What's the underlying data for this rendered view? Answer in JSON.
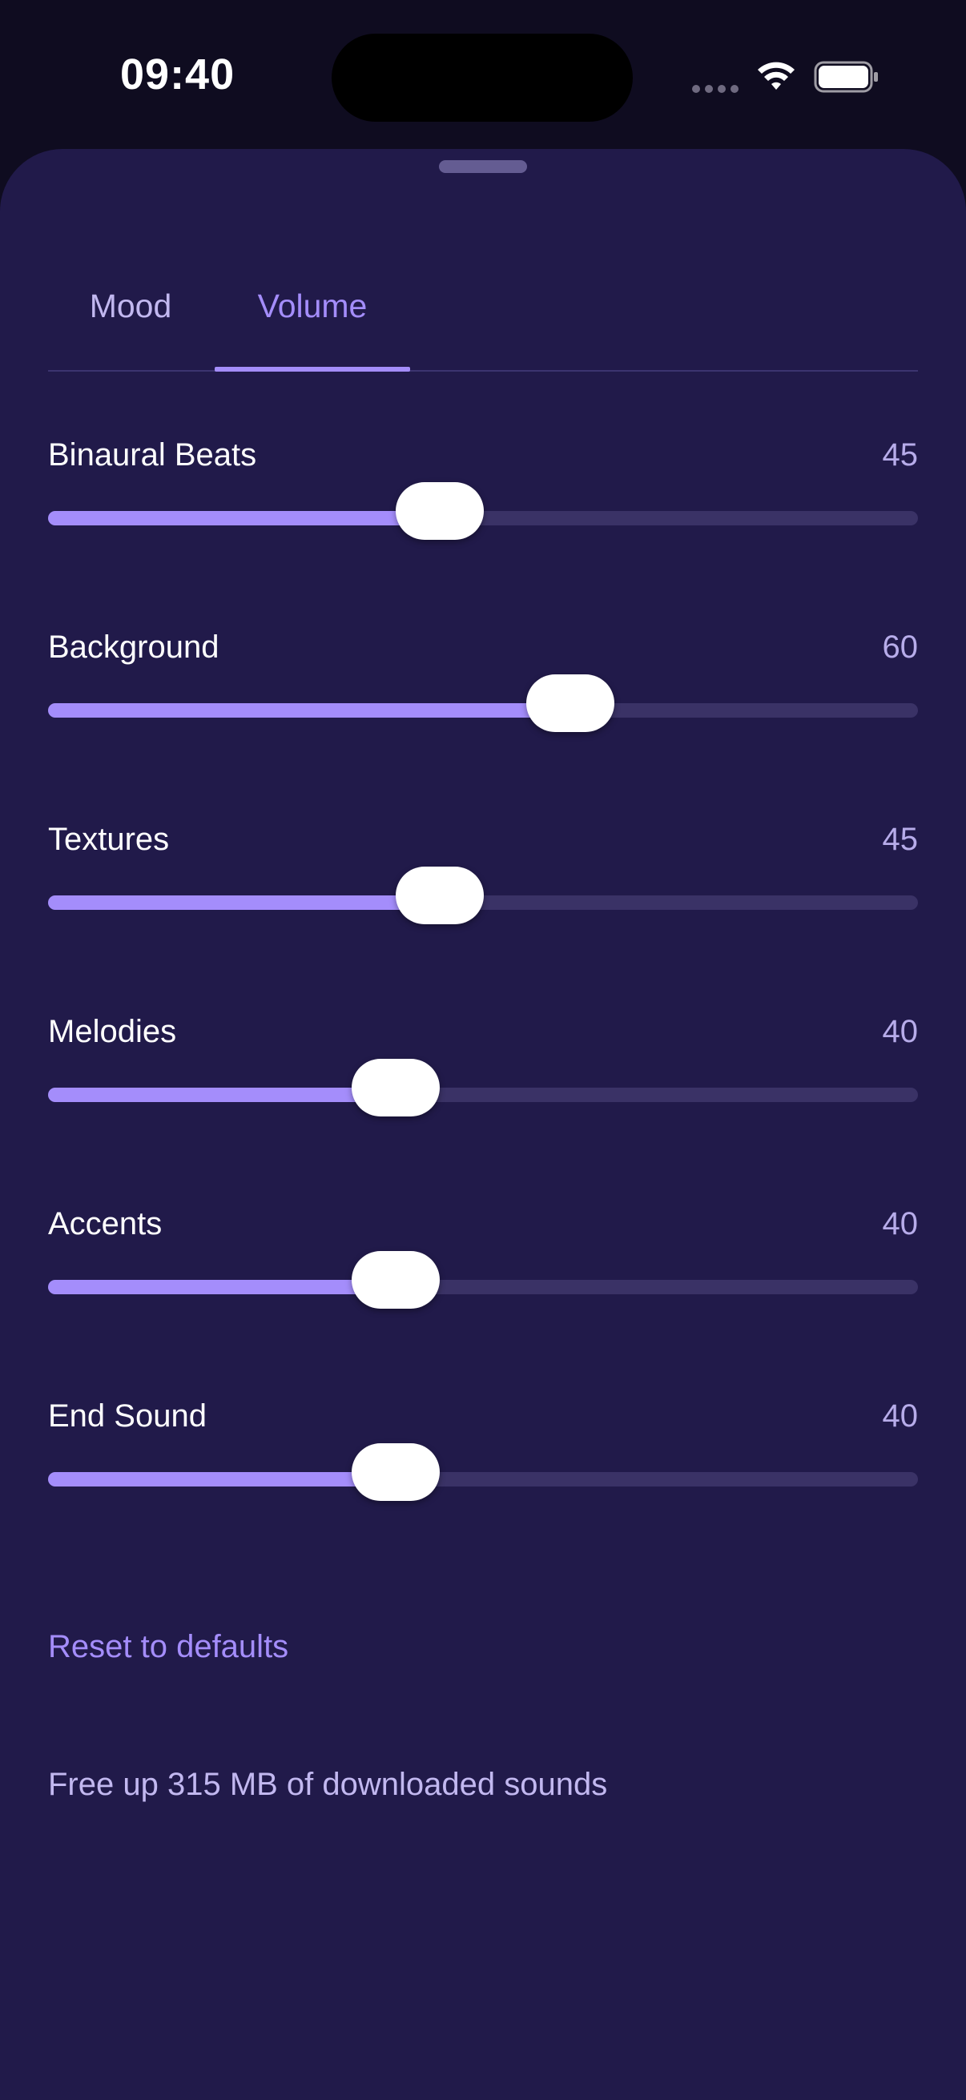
{
  "status_bar": {
    "time": "09:40",
    "icons": [
      "cellular-signal-icon",
      "wifi-icon",
      "battery-icon"
    ]
  },
  "tabs": [
    {
      "label": "Mood",
      "selected": false
    },
    {
      "label": "Volume",
      "selected": true
    }
  ],
  "sliders": [
    {
      "label": "Binaural Beats",
      "value": "45",
      "level": 0.45
    },
    {
      "label": "Background",
      "value": "60",
      "level": 0.6
    },
    {
      "label": "Textures",
      "value": "45",
      "level": 0.45
    },
    {
      "label": "Melodies",
      "value": "40",
      "level": 0.4
    },
    {
      "label": "Accents",
      "value": "40",
      "level": 0.4
    },
    {
      "label": "End Sound",
      "value": "40",
      "level": 0.4
    }
  ],
  "actions": {
    "reset_label": "Reset to defaults",
    "free_up_label": "Free up 315 MB of downloaded sounds"
  },
  "colors": {
    "accent": "#a48dfb",
    "sheet_background": "#211a4a",
    "screen_background": "#0f0c20",
    "track": "#3a3266"
  }
}
